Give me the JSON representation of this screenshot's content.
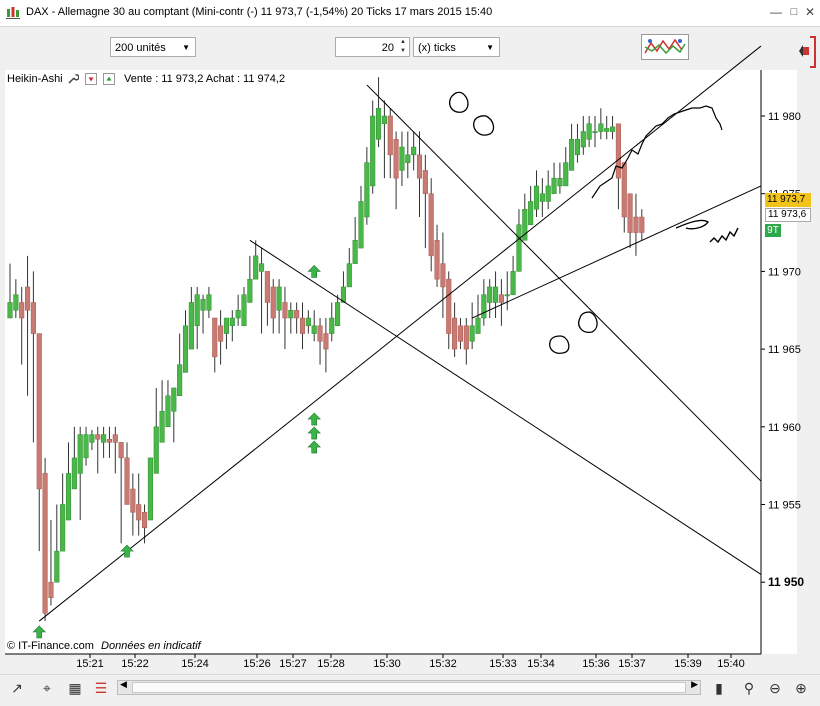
{
  "window": {
    "title": "DAX - Allemagne 30 au comptant (Mini-contr (-)    11 973,7 (-1,54%)    20 Ticks  17 mars 2015 15:40"
  },
  "toolbar": {
    "units_select": "200 unités",
    "ticks_value": "20",
    "ticks_unit_select": "(x) ticks"
  },
  "legend": {
    "chart_style": "Heikin-Ashi",
    "quote": "Vente : 11 973,2 Achat : 11 974,2"
  },
  "footer": {
    "copyright": "© IT-Finance.com",
    "note": "Données en indicatif"
  },
  "colors": {
    "up": "#49b849",
    "down": "#c97a72",
    "arrow": "#3cb34a",
    "price_tag": "#f2c318",
    "tag_9t": "#2da84a"
  },
  "chart_data": {
    "type": "candlestick",
    "subtype": "heikin-ashi",
    "interval": "20 Ticks",
    "y_axis": {
      "range": [
        11946.5,
        11983.5
      ],
      "ticks": [
        11950,
        11955,
        11960,
        11965,
        11970,
        11975,
        11980
      ],
      "tick_labels": [
        "11 950",
        "11 955",
        "11 960",
        "11 965",
        "11 970",
        "11 975",
        "11 980"
      ],
      "bold_tick": "11 950"
    },
    "x_axis": {
      "tick_labels": [
        "15:21",
        "15:22",
        "15:24",
        "15:26",
        "15:27",
        "15:28",
        "15:30",
        "15:32",
        "15:33",
        "15:34",
        "15:36",
        "15:37",
        "15:39",
        "15:40"
      ]
    },
    "price_labels": {
      "last": "11 973,7",
      "bid": "11 973,6",
      "tag": "9T"
    },
    "candles": [
      {
        "o": 11967.0,
        "c": 11968.0,
        "h": 11970.5,
        "l": 11967.0
      },
      {
        "o": 11967.5,
        "c": 11968.5,
        "h": 11969.5,
        "l": 11967.0
      },
      {
        "o": 11968.0,
        "c": 11967.0,
        "h": 11969.0,
        "l": 11964.0
      },
      {
        "o": 11969.0,
        "c": 11967.5,
        "h": 11971.0,
        "l": 11962.0
      },
      {
        "o": 11968.0,
        "c": 11966.0,
        "h": 11970.0,
        "l": 11959.0
      },
      {
        "o": 11966.0,
        "c": 11956.0,
        "h": 11966.0,
        "l": 11952.0
      },
      {
        "o": 11957.0,
        "c": 11948.0,
        "h": 11958.0,
        "l": 11947.5
      },
      {
        "o": 11950.0,
        "c": 11949.0,
        "h": 11954.0,
        "l": 11948.5
      },
      {
        "o": 11950.0,
        "c": 11952.0,
        "h": 11955.0,
        "l": 11950.0
      },
      {
        "o": 11952.0,
        "c": 11955.0,
        "h": 11957.0,
        "l": 11952.0
      },
      {
        "o": 11954.0,
        "c": 11957.0,
        "h": 11959.0,
        "l": 11954.0
      },
      {
        "o": 11956.0,
        "c": 11958.0,
        "h": 11960.0,
        "l": 11956.0
      },
      {
        "o": 11957.0,
        "c": 11959.5,
        "h": 11960.0,
        "l": 11954.0
      },
      {
        "o": 11958.0,
        "c": 11959.5,
        "h": 11960.0,
        "l": 11957.5
      },
      {
        "o": 11959.0,
        "c": 11959.5,
        "h": 11959.8,
        "l": 11958.5
      },
      {
        "o": 11959.5,
        "c": 11959.2,
        "h": 11960.0,
        "l": 11957.0
      },
      {
        "o": 11959.0,
        "c": 11959.5,
        "h": 11960.0,
        "l": 11958.0
      },
      {
        "o": 11959.2,
        "c": 11959.0,
        "h": 11960.0,
        "l": 11958.0
      },
      {
        "o": 11959.5,
        "c": 11959.0,
        "h": 11960.0,
        "l": 11957.0
      },
      {
        "o": 11959.0,
        "c": 11958.0,
        "h": 11959.0,
        "l": 11952.5
      },
      {
        "o": 11958.0,
        "c": 11955.0,
        "h": 11959.0,
        "l": 11955.0
      },
      {
        "o": 11956.0,
        "c": 11954.5,
        "h": 11957.0,
        "l": 11953.0
      },
      {
        "o": 11955.0,
        "c": 11954.0,
        "h": 11957.0,
        "l": 11953.0
      },
      {
        "o": 11954.5,
        "c": 11953.5,
        "h": 11955.0,
        "l": 11952.5
      },
      {
        "o": 11954.0,
        "c": 11958.0,
        "h": 11958.0,
        "l": 11954.0
      },
      {
        "o": 11957.0,
        "c": 11960.0,
        "h": 11962.5,
        "l": 11957.0
      },
      {
        "o": 11959.0,
        "c": 11961.0,
        "h": 11963.0,
        "l": 11959.0
      },
      {
        "o": 11960.0,
        "c": 11962.0,
        "h": 11963.0,
        "l": 11960.0
      },
      {
        "o": 11961.0,
        "c": 11962.5,
        "h": 11962.5,
        "l": 11959.0
      },
      {
        "o": 11962.0,
        "c": 11964.0,
        "h": 11966.0,
        "l": 11962.0
      },
      {
        "o": 11963.5,
        "c": 11966.5,
        "h": 11967.5,
        "l": 11963.5
      },
      {
        "o": 11965.0,
        "c": 11968.0,
        "h": 11969.0,
        "l": 11965.0
      },
      {
        "o": 11966.5,
        "c": 11968.5,
        "h": 11969.0,
        "l": 11965.0
      },
      {
        "o": 11967.5,
        "c": 11968.2,
        "h": 11968.5,
        "l": 11966.0
      },
      {
        "o": 11967.5,
        "c": 11968.5,
        "h": 11969.0,
        "l": 11967.0
      },
      {
        "o": 11967.0,
        "c": 11964.5,
        "h": 11967.0,
        "l": 11963.5
      },
      {
        "o": 11966.5,
        "c": 11965.5,
        "h": 11967.5,
        "l": 11964.0
      },
      {
        "o": 11966.0,
        "c": 11967.0,
        "h": 11967.0,
        "l": 11965.0
      },
      {
        "o": 11966.5,
        "c": 11967.0,
        "h": 11967.5,
        "l": 11965.5
      },
      {
        "o": 11967.0,
        "c": 11967.5,
        "h": 11968.5,
        "l": 11966.5
      },
      {
        "o": 11966.5,
        "c": 11968.5,
        "h": 11969.0,
        "l": 11966.5
      },
      {
        "o": 11968.0,
        "c": 11969.5,
        "h": 11971.0,
        "l": 11968.0
      },
      {
        "o": 11969.5,
        "c": 11971.0,
        "h": 11972.0,
        "l": 11969.5
      },
      {
        "o": 11970.0,
        "c": 11970.5,
        "h": 11971.5,
        "l": 11966.0
      },
      {
        "o": 11970.0,
        "c": 11968.0,
        "h": 11970.0,
        "l": 11966.5
      },
      {
        "o": 11969.0,
        "c": 11967.0,
        "h": 11969.5,
        "l": 11966.0
      },
      {
        "o": 11967.5,
        "c": 11969.0,
        "h": 11969.5,
        "l": 11966.0
      },
      {
        "o": 11968.0,
        "c": 11967.0,
        "h": 11969.0,
        "l": 11965.0
      },
      {
        "o": 11967.0,
        "c": 11967.5,
        "h": 11968.0,
        "l": 11966.0
      },
      {
        "o": 11967.5,
        "c": 11967.0,
        "h": 11968.0,
        "l": 11966.0
      },
      {
        "o": 11967.0,
        "c": 11966.0,
        "h": 11968.0,
        "l": 11965.0
      },
      {
        "o": 11966.5,
        "c": 11967.0,
        "h": 11967.5,
        "l": 11966.0
      },
      {
        "o": 11966.0,
        "c": 11966.5,
        "h": 11967.5,
        "l": 11965.5
      },
      {
        "o": 11966.5,
        "c": 11965.5,
        "h": 11967.0,
        "l": 11964.0
      },
      {
        "o": 11966.0,
        "c": 11965.0,
        "h": 11967.0,
        "l": 11963.5
      },
      {
        "o": 11966.0,
        "c": 11967.0,
        "h": 11968.0,
        "l": 11965.5
      },
      {
        "o": 11966.5,
        "c": 11968.0,
        "h": 11968.5,
        "l": 11966.5
      },
      {
        "o": 11968.0,
        "c": 11969.0,
        "h": 11970.0,
        "l": 11968.0
      },
      {
        "o": 11969.0,
        "c": 11970.5,
        "h": 11971.5,
        "l": 11969.0
      },
      {
        "o": 11970.5,
        "c": 11972.0,
        "h": 11973.5,
        "l": 11970.5
      },
      {
        "o": 11971.5,
        "c": 11974.5,
        "h": 11975.5,
        "l": 11971.5
      },
      {
        "o": 11973.5,
        "c": 11977.0,
        "h": 11978.0,
        "l": 11973.0
      },
      {
        "o": 11975.5,
        "c": 11980.0,
        "h": 11981.0,
        "l": 11975.0
      },
      {
        "o": 11978.5,
        "c": 11980.5,
        "h": 11982.5,
        "l": 11978.0
      },
      {
        "o": 11979.5,
        "c": 11980.0,
        "h": 11981.0,
        "l": 11976.0
      },
      {
        "o": 11980.0,
        "c": 11977.5,
        "h": 11980.5,
        "l": 11976.0
      },
      {
        "o": 11978.5,
        "c": 11976.0,
        "h": 11979.0,
        "l": 11974.0
      },
      {
        "o": 11976.5,
        "c": 11978.0,
        "h": 11979.0,
        "l": 11975.5
      },
      {
        "o": 11977.0,
        "c": 11977.5,
        "h": 11979.0,
        "l": 11976.0
      },
      {
        "o": 11977.5,
        "c": 11978.0,
        "h": 11979.0,
        "l": 11976.5
      },
      {
        "o": 11977.5,
        "c": 11976.0,
        "h": 11979.0,
        "l": 11973.5
      },
      {
        "o": 11976.5,
        "c": 11975.0,
        "h": 11977.5,
        "l": 11971.5
      },
      {
        "o": 11975.0,
        "c": 11971.0,
        "h": 11976.0,
        "l": 11970.0
      },
      {
        "o": 11972.0,
        "c": 11969.5,
        "h": 11973.0,
        "l": 11969.0
      },
      {
        "o": 11970.5,
        "c": 11969.0,
        "h": 11972.5,
        "l": 11967.0
      },
      {
        "o": 11969.5,
        "c": 11966.0,
        "h": 11970.0,
        "l": 11965.0
      },
      {
        "o": 11967.0,
        "c": 11965.0,
        "h": 11968.0,
        "l": 11964.5
      },
      {
        "o": 11966.5,
        "c": 11965.5,
        "h": 11967.0,
        "l": 11965.0
      },
      {
        "o": 11966.5,
        "c": 11965.0,
        "h": 11967.0,
        "l": 11964.0
      },
      {
        "o": 11965.5,
        "c": 11966.5,
        "h": 11968.0,
        "l": 11965.0
      },
      {
        "o": 11966.0,
        "c": 11967.0,
        "h": 11968.5,
        "l": 11966.0
      },
      {
        "o": 11967.0,
        "c": 11968.5,
        "h": 11969.5,
        "l": 11966.5
      },
      {
        "o": 11968.0,
        "c": 11969.0,
        "h": 11969.5,
        "l": 11967.0
      },
      {
        "o": 11968.0,
        "c": 11969.0,
        "h": 11970.0,
        "l": 11967.0
      },
      {
        "o": 11968.5,
        "c": 11968.0,
        "h": 11969.5,
        "l": 11966.5
      },
      {
        "o": 11968.5,
        "c": 11968.5,
        "h": 11970.0,
        "l": 11967.5
      },
      {
        "o": 11968.5,
        "c": 11970.0,
        "h": 11971.0,
        "l": 11968.5
      },
      {
        "o": 11970.0,
        "c": 11973.0,
        "h": 11974.0,
        "l": 11970.0
      },
      {
        "o": 11972.0,
        "c": 11974.0,
        "h": 11975.0,
        "l": 11972.0
      },
      {
        "o": 11973.0,
        "c": 11974.5,
        "h": 11975.5,
        "l": 11973.0
      },
      {
        "o": 11974.0,
        "c": 11975.5,
        "h": 11976.5,
        "l": 11973.5
      },
      {
        "o": 11974.5,
        "c": 11975.0,
        "h": 11976.0,
        "l": 11973.5
      },
      {
        "o": 11974.5,
        "c": 11975.5,
        "h": 11976.5,
        "l": 11974.0
      },
      {
        "o": 11975.0,
        "c": 11976.0,
        "h": 11977.0,
        "l": 11975.0
      },
      {
        "o": 11975.5,
        "c": 11976.0,
        "h": 11977.0,
        "l": 11975.0
      },
      {
        "o": 11975.5,
        "c": 11977.0,
        "h": 11978.0,
        "l": 11975.5
      },
      {
        "o": 11976.5,
        "c": 11978.5,
        "h": 11979.5,
        "l": 11976.5
      },
      {
        "o": 11977.5,
        "c": 11978.5,
        "h": 11979.5,
        "l": 11977.0
      },
      {
        "o": 11978.0,
        "c": 11979.0,
        "h": 11980.0,
        "l": 11977.5
      },
      {
        "o": 11978.5,
        "c": 11979.5,
        "h": 11980.0,
        "l": 11978.0
      },
      {
        "o": 11979.0,
        "c": 11979.0,
        "h": 11980.0,
        "l": 11978.0
      },
      {
        "o": 11979.0,
        "c": 11979.5,
        "h": 11980.5,
        "l": 11978.5
      },
      {
        "o": 11979.0,
        "c": 11979.2,
        "h": 11980.0,
        "l": 11978.5
      },
      {
        "o": 11979.0,
        "c": 11979.3,
        "h": 11980.0,
        "l": 11978.5
      },
      {
        "o": 11979.5,
        "c": 11976.0,
        "h": 11979.5,
        "l": 11974.0
      },
      {
        "o": 11977.0,
        "c": 11973.5,
        "h": 11977.0,
        "l": 11972.5
      },
      {
        "o": 11975.0,
        "c": 11972.5,
        "h": 11975.0,
        "l": 11971.5
      },
      {
        "o": 11973.5,
        "c": 11972.5,
        "h": 11975.0,
        "l": 11971.0
      },
      {
        "o": 11973.5,
        "c": 11972.5,
        "h": 11974.0,
        "l": 11972.0
      }
    ],
    "signal_arrows": [
      {
        "candle": 5,
        "price": 11946.8,
        "stack": 1
      },
      {
        "candle": 20,
        "price": 11952.0,
        "stack": 1
      },
      {
        "candle": 52,
        "price": 11970.0,
        "stack": 1
      },
      {
        "candle": 52,
        "price": 11960.5,
        "stack": 3
      }
    ],
    "trend_lines": [
      {
        "from": {
          "candle": 5,
          "price": 11947.5
        },
        "to": {
          "candle": 130,
          "price": 11984.5
        }
      },
      {
        "from": {
          "candle": 41,
          "price": 11972.0
        },
        "to": {
          "candle": 130,
          "price": 11950.5
        }
      },
      {
        "from": {
          "candle": 61,
          "price": 11982.0
        },
        "to": {
          "candle": 130,
          "price": 11956.5
        }
      },
      {
        "from": {
          "candle": 79,
          "price": 11967.0
        },
        "to": {
          "candle": 130,
          "price": 11975.5
        }
      }
    ]
  }
}
